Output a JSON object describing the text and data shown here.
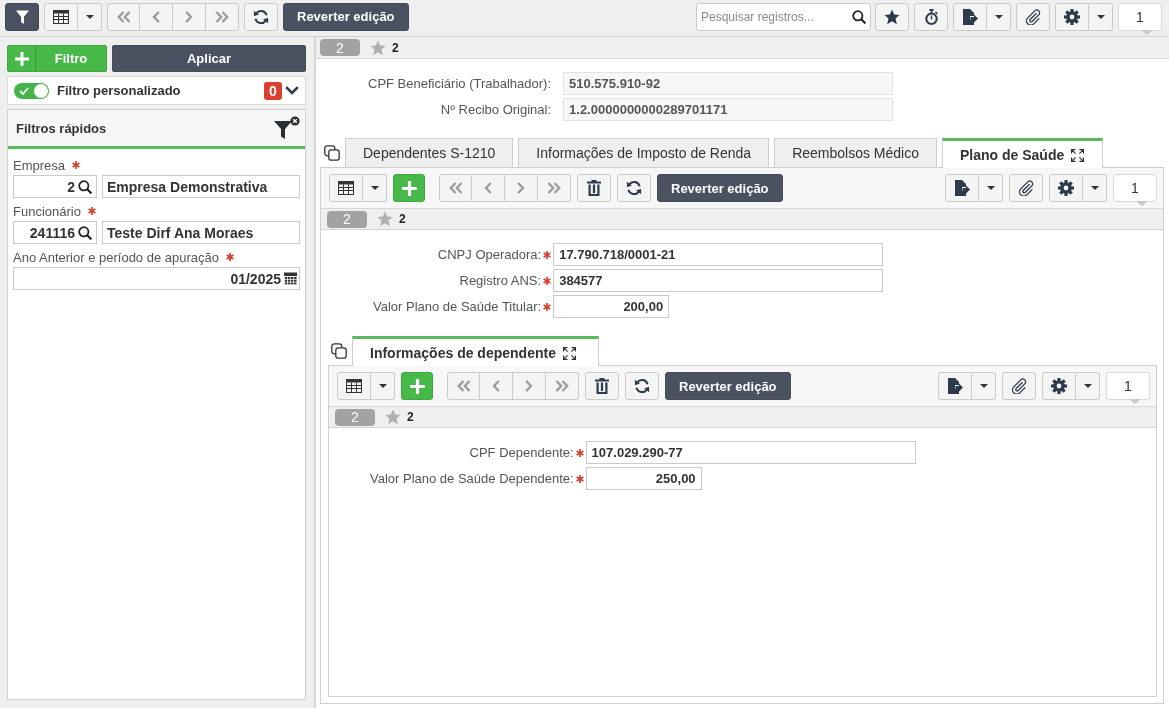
{
  "toolbar": {
    "nav_disabled": true,
    "revert_button": "Reverter edição",
    "search": {
      "placeholder": "Pesquisar registros..."
    },
    "page": "1"
  },
  "filter_panel": {
    "add_button": "Filtro",
    "apply_button": "Aplicar",
    "custom_filter": {
      "on": true,
      "label": "Filtro personalizado",
      "count": "0"
    },
    "quick_filters": {
      "title": "Filtros rápidos",
      "fields": [
        {
          "kind": "lookup",
          "label": "Empresa",
          "required": true,
          "lookup": {
            "code": "2",
            "description": "Empresa Demonstrativa"
          }
        },
        {
          "kind": "lookup",
          "label": "Funcionário",
          "required": true,
          "lookup": {
            "code": "241116",
            "description": "Teste Dirf Ana Moraes"
          }
        },
        {
          "kind": "date",
          "label": "Ano Anterior e período de apuração",
          "required": true,
          "value": "01/2025"
        }
      ]
    }
  },
  "record_bar": {
    "number": "2",
    "favorites": "2"
  },
  "fields": [
    {
      "kind": "text",
      "label": "CPF Beneficiário (Trabalhador):",
      "required": false,
      "readonly": true,
      "value": "510.575.910-92"
    },
    {
      "kind": "text",
      "label": "Nº Recibo Original:",
      "required": false,
      "readonly": true,
      "value": "1.2.0000000000289701171"
    }
  ],
  "tabs": [
    {
      "label": "Dependentes S-1210",
      "selected": false
    },
    {
      "label": "Informações de Imposto de Renda",
      "selected": false
    },
    {
      "label": "Reembolsos Médico",
      "selected": false
    },
    {
      "label": "Plano de Saúde",
      "selected": true
    }
  ],
  "tab_panel": {
    "toolbar": {
      "nav_disabled": true,
      "revert_button": "Reverter edição",
      "page": "1"
    },
    "record_bar": {
      "number": "2",
      "favorites": "2"
    },
    "fields": [
      {
        "kind": "text",
        "label": "CNPJ Operadora:",
        "required": true,
        "readonly": false,
        "value": "17.790.718/0001-21"
      },
      {
        "kind": "text",
        "label": "Registro ANS:",
        "required": true,
        "readonly": false,
        "value": "384577"
      },
      {
        "kind": "money",
        "label": "Valor Plano de Saúde Titular:",
        "required": true,
        "readonly": false,
        "value": "200,00"
      }
    ],
    "subtabs": [
      {
        "label": "Informações de dependente",
        "selected": true
      }
    ],
    "subpanel": {
      "toolbar": {
        "nav_disabled": true,
        "revert_button": "Reverter edição",
        "page": "1"
      },
      "record_bar": {
        "number": "2",
        "favorites": "2"
      },
      "fields": [
        {
          "kind": "text",
          "label": "CPF Dependente:",
          "required": true,
          "readonly": false,
          "value": "107.029.290-77"
        },
        {
          "kind": "money",
          "label": "Valor Plano de Saúde Dependente:",
          "required": true,
          "readonly": false,
          "value": "250,00"
        }
      ]
    }
  }
}
